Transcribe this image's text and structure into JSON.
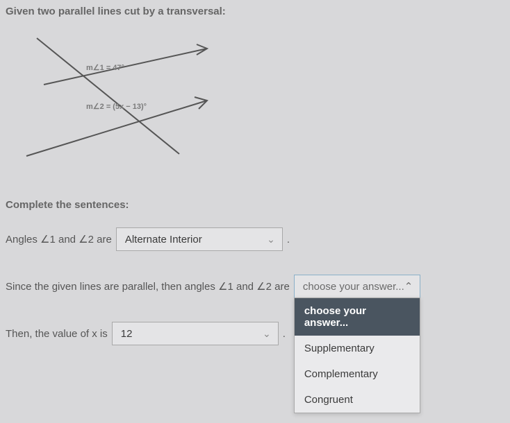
{
  "intro": "Given two parallel lines cut by a transversal:",
  "diagram": {
    "label1": "m∠1 = 47°",
    "label2": "m∠2 = (5x − 13)°"
  },
  "complete": "Complete the sentences:",
  "sentence1": {
    "prefix": "Angles ∠1 and ∠2 are",
    "select_value": "Alternate Interior",
    "period": "."
  },
  "sentence2": {
    "prefix": "Since the given lines are parallel, then angles ∠1 and ∠2 are",
    "select_value": "choose your answer...",
    "dropdown": {
      "options": [
        "choose your answer...",
        "Supplementary",
        "Complementary",
        "Congruent"
      ],
      "selected_index": 0
    }
  },
  "sentence3": {
    "prefix": "Then, the value of x is",
    "select_value": "12",
    "period": "."
  }
}
